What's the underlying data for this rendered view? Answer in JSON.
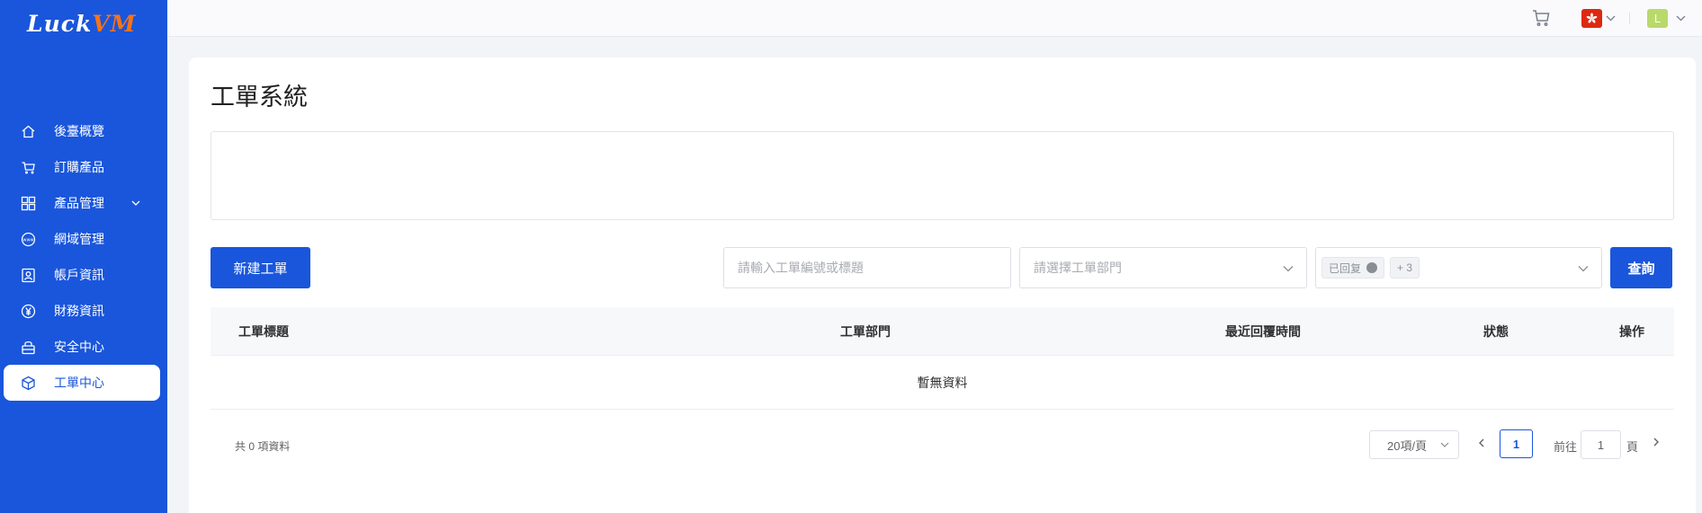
{
  "app": {
    "logo_part1": "Luck",
    "logo_part2": "VM",
    "brand_color": "#1a56db",
    "logo_accent": "#f97316"
  },
  "sidebar": {
    "items": [
      {
        "label": "後臺概覽",
        "icon": "home-icon"
      },
      {
        "label": "訂購產品",
        "icon": "cart-icon"
      },
      {
        "label": "產品管理",
        "icon": "grid-icon",
        "expandable": true
      },
      {
        "label": "網域管理",
        "icon": "www-icon"
      },
      {
        "label": "帳戶資訊",
        "icon": "user-card-icon"
      },
      {
        "label": "財務資訊",
        "icon": "yen-icon"
      },
      {
        "label": "安全中心",
        "icon": "lock-icon"
      },
      {
        "label": "工單中心",
        "icon": "box-icon",
        "active": true
      }
    ]
  },
  "header": {
    "cart_icon": "cart-icon",
    "language_flag": "hong-kong-flag",
    "user_avatar_letter": "L"
  },
  "page": {
    "title": "工單系統",
    "new_ticket_label": "新建工單",
    "search_placeholder": "請輸入工單編號或標題",
    "department_placeholder": "請選擇工單部門",
    "status_tag": "已回复",
    "status_more": "+ 3",
    "query_label": "查詢"
  },
  "table": {
    "columns": [
      "工單標題",
      "工單部門",
      "最近回覆時間",
      "狀態",
      "操作"
    ],
    "empty_text": "暫無資料"
  },
  "pagination": {
    "total_text": "共 0 項資料",
    "page_size": "20項/頁",
    "current_page": "1",
    "goto_prefix": "前往",
    "goto_value": "1",
    "goto_suffix": "頁"
  }
}
